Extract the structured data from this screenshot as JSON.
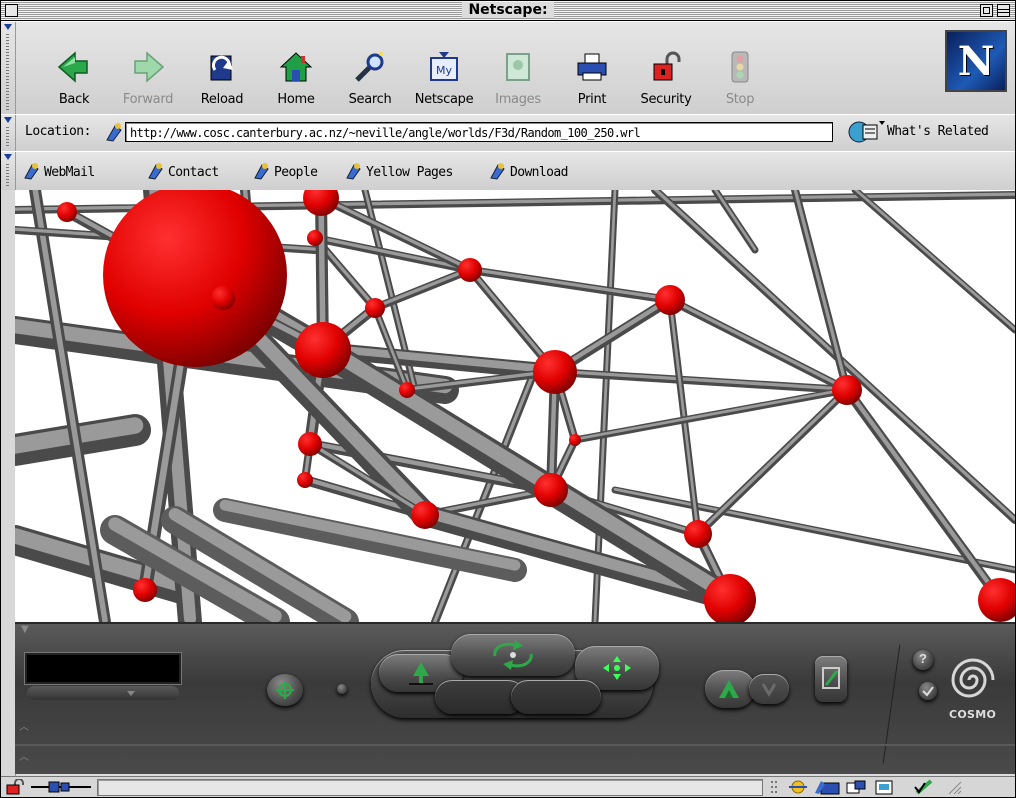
{
  "window": {
    "title": "Netscape:"
  },
  "toolbar": {
    "buttons": [
      {
        "label": "Back",
        "icon": "back-arrow-icon",
        "enabled": true
      },
      {
        "label": "Forward",
        "icon": "forward-arrow-icon",
        "enabled": false
      },
      {
        "label": "Reload",
        "icon": "reload-icon",
        "enabled": true
      },
      {
        "label": "Home",
        "icon": "home-icon",
        "enabled": true
      },
      {
        "label": "Search",
        "icon": "search-icon",
        "enabled": true
      },
      {
        "label": "Netscape",
        "icon": "my-netscape-icon",
        "enabled": true
      },
      {
        "label": "Images",
        "icon": "images-icon",
        "enabled": false
      },
      {
        "label": "Print",
        "icon": "printer-icon",
        "enabled": true
      },
      {
        "label": "Security",
        "icon": "padlock-icon",
        "enabled": true
      },
      {
        "label": "Stop",
        "icon": "stop-icon",
        "enabled": false
      }
    ],
    "logo_letter": "N"
  },
  "location": {
    "label": "Location:",
    "url": "http://www.cosc.canterbury.ac.nz/~neville/angle/worlds/F3d/Random_100_250.wrl",
    "related_label": "What's Related"
  },
  "personal_toolbar": {
    "items": [
      "WebMail",
      "Contact",
      "People",
      "Yellow Pages",
      "Download"
    ]
  },
  "cosmo": {
    "brand": "COSMO",
    "help": "?",
    "viewpoint_name": ""
  },
  "colors": {
    "node": "#e00000",
    "edge": "#8a8a8a",
    "panel": "#464646",
    "nav_green": "#2fa84a"
  }
}
